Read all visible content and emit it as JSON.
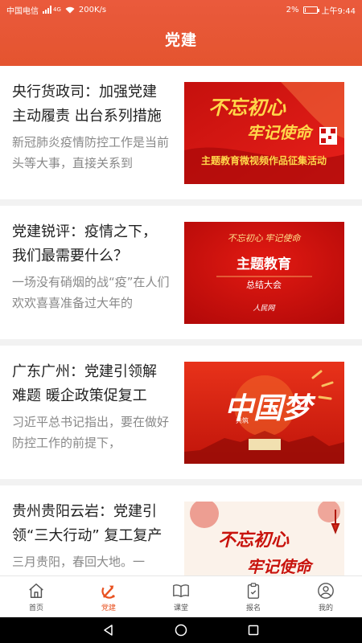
{
  "status": {
    "carrier": "中国电信",
    "net_type": "4G",
    "speed": "200K/s",
    "battery_pct": "2%",
    "time": "上午9:44"
  },
  "header": {
    "title": "党建"
  },
  "articles": [
    {
      "title": "央行货政司：加强党建主动履责 出台系列措施",
      "desc": "新冠肺炎疫情防控工作是当前头等大事，直接关系到",
      "thumb": {
        "line1": "不忘初心",
        "line2": "牢记使命",
        "caption": "主题教育微视频作品征集活动"
      }
    },
    {
      "title": "党建锐评：疫情之下，我们最需要什么？",
      "desc": "一场没有硝烟的战“疫”在人们欢欢喜喜准备过大年的",
      "thumb": {
        "line1": "不忘初心 牢记使命",
        "line2": "主题教育",
        "caption": "总结大会",
        "logo": "人民网"
      }
    },
    {
      "title": "广东广州：党建引领解难题 暖企政策促复工",
      "desc": "习近平总书记指出，要在做好防控工作的前提下，",
      "thumb": {
        "line1": "中国梦",
        "line2": "共筑"
      }
    },
    {
      "title": "贵州贵阳云岩：党建引领“三大行动” 复工复产",
      "desc": "三月贵阳，春回大地。一",
      "thumb": {
        "line1": "不忘初心",
        "line2": "牢记使命"
      }
    }
  ],
  "tabs": [
    {
      "label": "首页",
      "icon": "home-icon",
      "active": false
    },
    {
      "label": "党建",
      "icon": "party-emblem-icon",
      "active": true
    },
    {
      "label": "课堂",
      "icon": "book-icon",
      "active": false
    },
    {
      "label": "报名",
      "icon": "clipboard-icon",
      "active": false
    },
    {
      "label": "我的",
      "icon": "user-icon",
      "active": false
    }
  ],
  "colors": {
    "brand": "#e4542f",
    "active_tab": "#e8501f"
  }
}
